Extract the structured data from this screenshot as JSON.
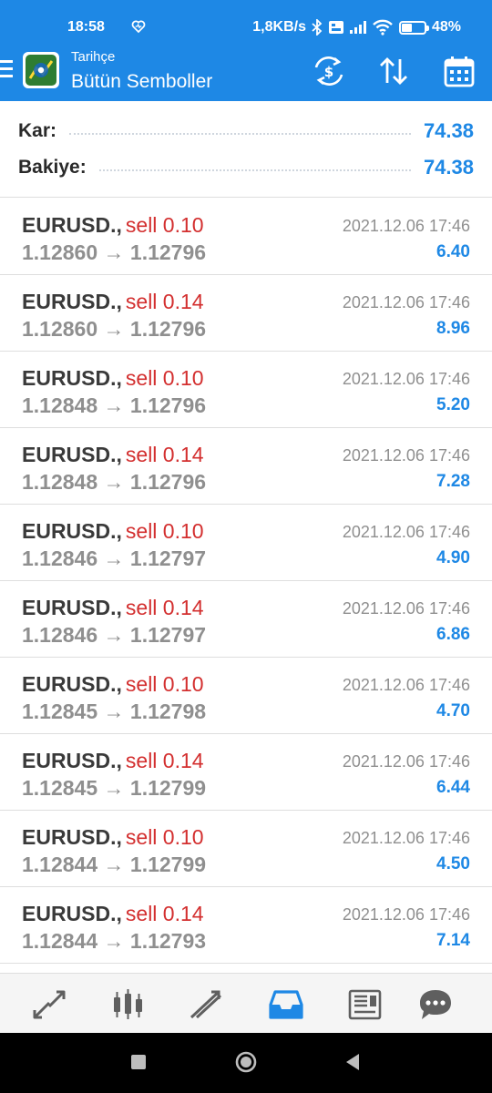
{
  "status": {
    "time": "18:58",
    "network_speed": "1,8KB/s",
    "battery": "48%",
    "battery_level": 0.48,
    "icons": [
      "heart-icon",
      "bluetooth-icon",
      "volte-icon",
      "signal-icon",
      "wifi-icon",
      "battery-icon"
    ]
  },
  "appbar": {
    "subtitle": "Tarihçe",
    "title": "Bütün Semboller",
    "actions": [
      "currency-exchange-icon",
      "sort-icon",
      "calendar-icon"
    ]
  },
  "summary": {
    "profit_label": "Kar:",
    "profit_value": "74.38",
    "balance_label": "Bakiye:",
    "balance_value": "74.38"
  },
  "deals": [
    {
      "symbol": "EURUSD.,",
      "type": "sell 0.10",
      "open": "1.12860",
      "close": "1.12796",
      "time": "2021.12.06 17:46",
      "profit": "6.40"
    },
    {
      "symbol": "EURUSD.,",
      "type": "sell 0.14",
      "open": "1.12860",
      "close": "1.12796",
      "time": "2021.12.06 17:46",
      "profit": "8.96"
    },
    {
      "symbol": "EURUSD.,",
      "type": "sell 0.10",
      "open": "1.12848",
      "close": "1.12796",
      "time": "2021.12.06 17:46",
      "profit": "5.20"
    },
    {
      "symbol": "EURUSD.,",
      "type": "sell 0.14",
      "open": "1.12848",
      "close": "1.12796",
      "time": "2021.12.06 17:46",
      "profit": "7.28"
    },
    {
      "symbol": "EURUSD.,",
      "type": "sell 0.10",
      "open": "1.12846",
      "close": "1.12797",
      "time": "2021.12.06 17:46",
      "profit": "4.90"
    },
    {
      "symbol": "EURUSD.,",
      "type": "sell 0.14",
      "open": "1.12846",
      "close": "1.12797",
      "time": "2021.12.06 17:46",
      "profit": "6.86"
    },
    {
      "symbol": "EURUSD.,",
      "type": "sell 0.10",
      "open": "1.12845",
      "close": "1.12798",
      "time": "2021.12.06 17:46",
      "profit": "4.70"
    },
    {
      "symbol": "EURUSD.,",
      "type": "sell 0.14",
      "open": "1.12845",
      "close": "1.12799",
      "time": "2021.12.06 17:46",
      "profit": "6.44"
    },
    {
      "symbol": "EURUSD.,",
      "type": "sell 0.10",
      "open": "1.12844",
      "close": "1.12799",
      "time": "2021.12.06 17:46",
      "profit": "4.50"
    },
    {
      "symbol": "EURUSD.,",
      "type": "sell 0.14",
      "open": "1.12844",
      "close": "1.12793",
      "time": "2021.12.06 17:46",
      "profit": "7.14"
    }
  ],
  "price_arrow": "→",
  "tabs": [
    {
      "icon": "quotes-icon",
      "active": false
    },
    {
      "icon": "chart-icon",
      "active": false
    },
    {
      "icon": "trade-icon",
      "active": false
    },
    {
      "icon": "history-icon",
      "active": true
    },
    {
      "icon": "news-icon",
      "active": false
    },
    {
      "icon": "chat-icon",
      "active": false
    }
  ],
  "system_nav": [
    "recents-icon",
    "home-icon",
    "back-icon"
  ],
  "colors": {
    "primary": "#1e88e5",
    "sell": "#d32f2f",
    "muted": "#8f8f8f",
    "tab_inactive": "#5f5f5f"
  }
}
